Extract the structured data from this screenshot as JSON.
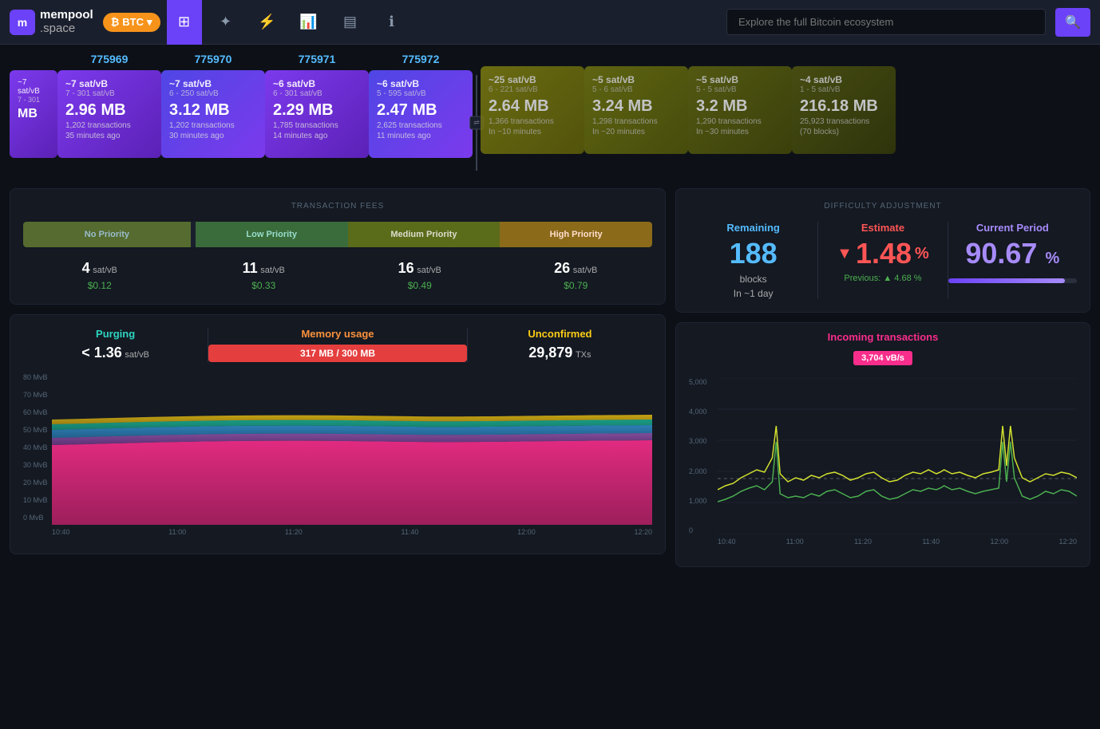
{
  "header": {
    "logo": "mempool",
    "logo_sub": ".space",
    "btc_label": "BTC",
    "search_placeholder": "Explore the full Bitcoin ecosystem",
    "nav_icons": [
      "dashboard",
      "tools",
      "lightning",
      "charts",
      "mining",
      "info"
    ]
  },
  "blocks": {
    "confirmed": [
      {
        "number": "775969",
        "sat": "~7 sat/vB",
        "sat_range": "7 - 301 sat/vB",
        "size": "2.96 MB",
        "txs": "1,202 transactions",
        "time": "35 minutes ago",
        "color": "purple"
      },
      {
        "number": "775970",
        "sat": "~7 sat/vB",
        "sat_range": "6 - 250 sat/vB",
        "size": "3.12 MB",
        "txs": "1,202 transactions",
        "time": "30 minutes ago",
        "color": "blue-purple"
      },
      {
        "number": "775971",
        "sat": "~6 sat/vB",
        "sat_range": "6 - 301 sat/vB",
        "size": "2.29 MB",
        "txs": "1,785 transactions",
        "time": "14 minutes ago",
        "color": "purple"
      },
      {
        "number": "775972",
        "sat": "~6 sat/vB",
        "sat_range": "5 - 595 sat/vB",
        "size": "2.47 MB",
        "txs": "2,625 transactions",
        "time": "11 minutes ago",
        "color": "blue-purple"
      }
    ],
    "pending": [
      {
        "sat": "~25 sat/vB",
        "sat_range": "6 - 221 sat/vB",
        "size": "2.64 MB",
        "txs": "1,366 transactions",
        "time": "In ~10 minutes",
        "color": "olive1"
      },
      {
        "sat": "~5 sat/vB",
        "sat_range": "5 - 6 sat/vB",
        "size": "3.24 MB",
        "txs": "1,298 transactions",
        "time": "In ~20 minutes",
        "color": "olive2"
      },
      {
        "sat": "~5 sat/vB",
        "sat_range": "5 - 5 sat/vB",
        "size": "3.2 MB",
        "txs": "1,290 transactions",
        "time": "In ~30 minutes",
        "color": "olive3"
      },
      {
        "sat": "~4 sat/vB",
        "sat_range": "1 - 5 sat/vB",
        "size": "216.18 MB",
        "txs": "25,923 transactions",
        "time": "(70 blocks)",
        "color": "olive4"
      }
    ]
  },
  "transaction_fees": {
    "title": "TRANSACTION FEES",
    "segments": [
      {
        "label": "No Priority",
        "color": "#4a5a20"
      },
      {
        "label": "Low Priority",
        "color": "#2a6a2a"
      },
      {
        "label": "Medium Priority",
        "color": "#6a6a10"
      },
      {
        "label": "High Priority",
        "color": "#a07010"
      }
    ],
    "fees": [
      {
        "priority": "No Priority",
        "sat": "4",
        "unit": "sat/vB",
        "usd": "$0.12"
      },
      {
        "priority": "Low Priority",
        "sat": "11",
        "unit": "sat/vB",
        "usd": "$0.33"
      },
      {
        "priority": "Medium Priority",
        "sat": "16",
        "unit": "sat/vB",
        "usd": "$0.49"
      },
      {
        "priority": "High Priority",
        "sat": "26",
        "unit": "sat/vB",
        "usd": "$0.79"
      }
    ]
  },
  "difficulty": {
    "title": "DIFFICULTY ADJUSTMENT",
    "remaining_label": "Remaining",
    "remaining_value": "188",
    "remaining_unit": "blocks",
    "remaining_sub": "In ~1 day",
    "estimate_label": "Estimate",
    "estimate_value": "1.48",
    "estimate_dir": "▼",
    "estimate_pct": "%",
    "estimate_prev_label": "Previous:",
    "estimate_prev_dir": "▲",
    "estimate_prev_value": "4.68",
    "estimate_prev_pct": "%",
    "period_label": "Current Period",
    "period_value": "90.67",
    "period_pct": "%",
    "period_progress": 90.67
  },
  "mempool": {
    "purging_label": "Purging",
    "purging_value": "< 1.36",
    "purging_unit": "sat/vB",
    "memory_label": "Memory usage",
    "memory_bar": "317 MB / 300 MB",
    "unconfirmed_label": "Unconfirmed",
    "unconfirmed_value": "29,879",
    "unconfirmed_unit": "TXs"
  },
  "mempool_chart": {
    "y_labels": [
      "80 MvB",
      "70 MvB",
      "60 MvB",
      "50 MvB",
      "40 MvB",
      "30 MvB",
      "20 MvB",
      "10 MvB",
      "0 MvB"
    ],
    "x_labels": [
      "10:40",
      "11:00",
      "11:20",
      "11:40",
      "12:00",
      "12:20"
    ]
  },
  "incoming": {
    "title": "Incoming transactions",
    "rate": "3,704 vB/s",
    "y_labels": [
      "5,000",
      "4,000",
      "3,000",
      "2,000",
      "1,000",
      "0"
    ],
    "x_labels": [
      "10:40",
      "11:00",
      "11:20",
      "11:40",
      "12:00",
      "12:20"
    ],
    "dashed_line": 1800
  }
}
